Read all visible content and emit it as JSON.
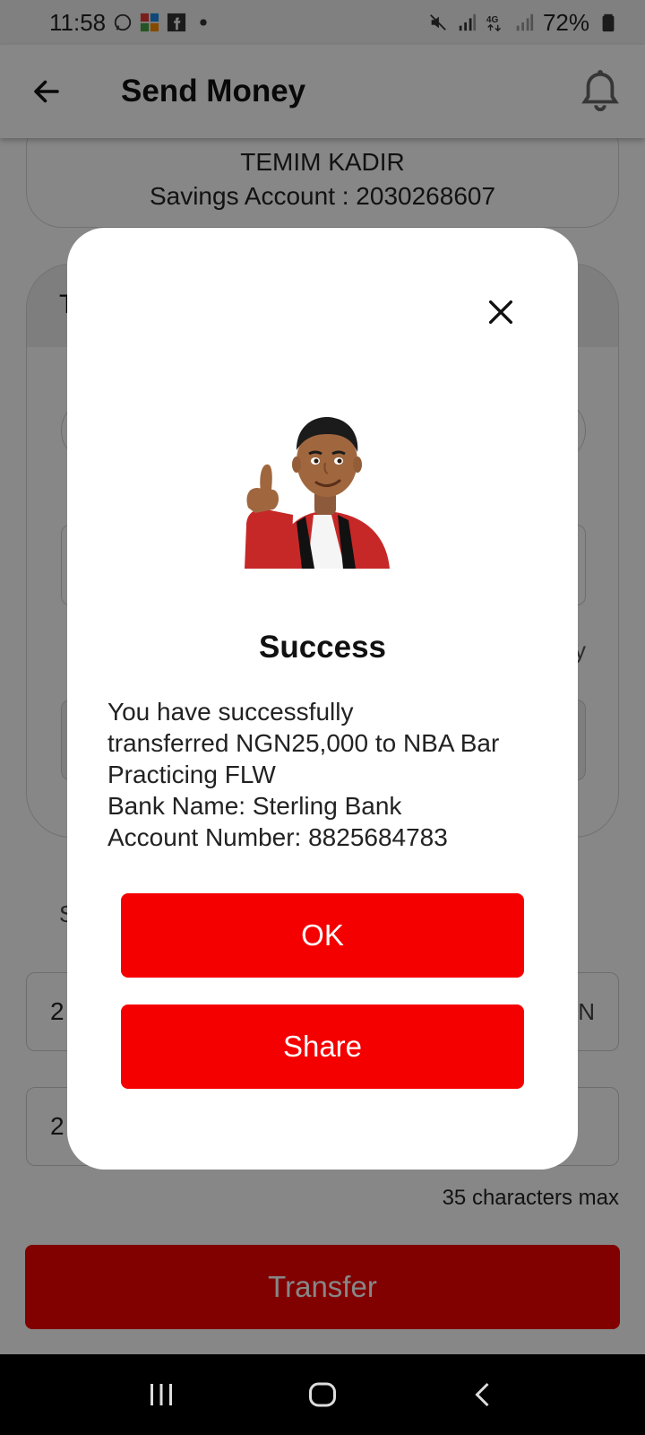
{
  "status_bar": {
    "time": "11:58",
    "battery": "72%",
    "icons": [
      "whatsapp-icon",
      "office-icon",
      "facebook-icon",
      "dot-icon",
      "mute-icon",
      "signal-icon",
      "4g-icon",
      "signal-icon",
      "battery-icon"
    ]
  },
  "app_bar": {
    "title": "Send Money",
    "back_icon": "arrow-left-icon",
    "bell_icon": "bell-icon"
  },
  "account": {
    "name": "TEMIM KADIR",
    "number_line": "Savings Account : 2030268607"
  },
  "form": {
    "card_head_fragment": "T",
    "hint_fragment": "y",
    "section_fragment": "S",
    "amount_fragment": "2",
    "currency_fragment": "GN",
    "narration_fragment": "2",
    "char_hint": "35 characters max",
    "transfer_label": "Transfer"
  },
  "dialog": {
    "title": "Success",
    "message_lines": [
      "You have successfully",
      "transferred NGN25,000 to NBA Bar",
      "Practicing FLW",
      "Bank Name: Sterling Bank",
      "Account Number: 8825684783"
    ],
    "ok_label": "OK",
    "share_label": "Share",
    "close_icon": "close-icon",
    "illustration": "thumbs-up-avatar"
  },
  "colors": {
    "brand_red": "#f40000",
    "scrim": "rgba(0,0,0,0.47)"
  },
  "nav_bar": {
    "icons": [
      "recents-icon",
      "home-icon",
      "back-icon"
    ]
  }
}
